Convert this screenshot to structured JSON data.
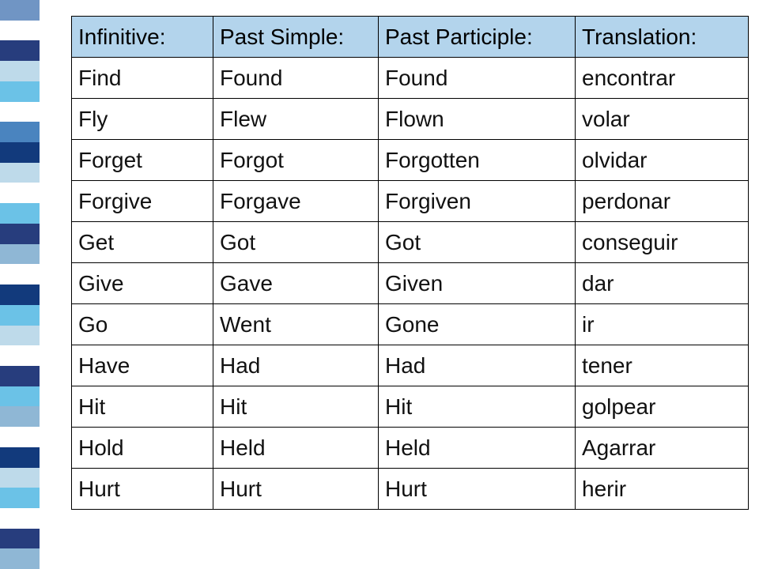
{
  "left_stripes": [
    "#7095c4",
    "#ffffff",
    "#273d7d",
    "#bedaea",
    "#6bc2e7",
    "#ffffff",
    "#4a84bf",
    "#123a7c",
    "#bedaea",
    "#ffffff",
    "#6bc2e7",
    "#273d7d",
    "#8fb7d5",
    "#ffffff",
    "#123a7c",
    "#6bc2e7",
    "#bedaea",
    "#ffffff",
    "#273d7d",
    "#6bc2e7",
    "#8fb7d5",
    "#ffffff",
    "#123a7c",
    "#bedaea",
    "#6bc2e7",
    "#ffffff",
    "#273d7d",
    "#8fb7d5"
  ],
  "headers": {
    "infinitive": "Infinitive:",
    "past_simple": "Past Simple:",
    "past_participle": "Past Participle:",
    "translation": "Translation:"
  },
  "chart_data": {
    "type": "table",
    "columns": [
      "Infinitive",
      "Past Simple",
      "Past Participle",
      "Translation"
    ],
    "rows": [
      {
        "infinitive": "Find",
        "past_simple": "Found",
        "past_participle": "Found",
        "translation": "encontrar"
      },
      {
        "infinitive": "Fly",
        "past_simple": "Flew",
        "past_participle": "Flown",
        "translation": "volar"
      },
      {
        "infinitive": "Forget",
        "past_simple": "Forgot",
        "past_participle": "Forgotten",
        "translation": "olvidar"
      },
      {
        "infinitive": "Forgive",
        "past_simple": "Forgave",
        "past_participle": "Forgiven",
        "translation": "perdonar"
      },
      {
        "infinitive": "Get",
        "past_simple": "Got",
        "past_participle": "Got",
        "translation": "conseguir"
      },
      {
        "infinitive": "Give",
        "past_simple": "Gave",
        "past_participle": "Given",
        "translation": "dar"
      },
      {
        "infinitive": "Go",
        "past_simple": "Went",
        "past_participle": "Gone",
        "translation": "ir"
      },
      {
        "infinitive": "Have",
        "past_simple": "Had",
        "past_participle": "Had",
        "translation": "tener"
      },
      {
        "infinitive": "Hit",
        "past_simple": "Hit",
        "past_participle": "Hit",
        "translation": "golpear"
      },
      {
        "infinitive": "Hold",
        "past_simple": "Held",
        "past_participle": "Held",
        "translation": "Agarrar"
      },
      {
        "infinitive": "Hurt",
        "past_simple": "Hurt",
        "past_participle": "Hurt",
        "translation": "herir"
      }
    ]
  }
}
